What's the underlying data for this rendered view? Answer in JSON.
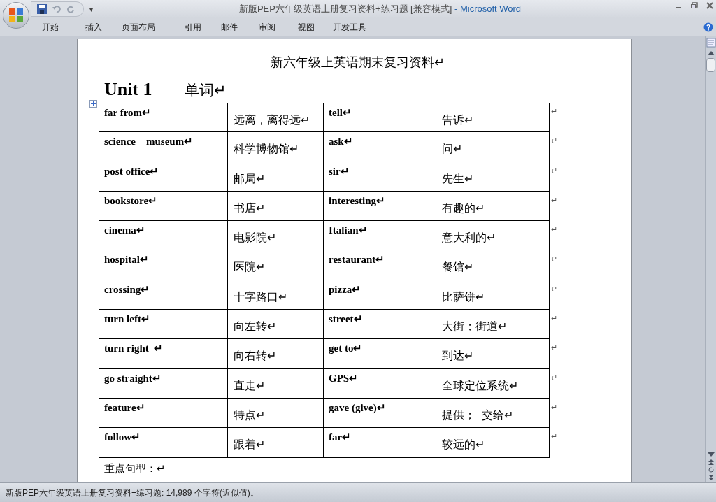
{
  "window": {
    "title": "新版PEP六年级英语上册复习资料+练习题 [兼容模式]",
    "app": "- Microsoft Word"
  },
  "quick_access": {
    "customize": "▾"
  },
  "tabs": [
    {
      "label": "开始",
      "selected": false
    },
    {
      "label": "插入",
      "selected": false
    },
    {
      "label": "页面布局",
      "selected": false
    },
    {
      "label": "引用",
      "selected": false
    },
    {
      "label": "邮件",
      "selected": false
    },
    {
      "label": "审阅",
      "selected": false
    },
    {
      "label": "视图",
      "selected": false
    },
    {
      "label": "开发工具",
      "selected": false
    }
  ],
  "document": {
    "title": "新六年级上英语期末复习资料↵",
    "unit": "Unit 1",
    "heading": "单词↵",
    "table": {
      "rows": [
        {
          "cells": [
            "far from↵",
            "远离，离得远↵",
            "tell↵",
            "告诉↵"
          ],
          "end_mark": "↵"
        },
        {
          "cells": [
            "science    museum↵",
            "科学博物馆↵",
            "ask↵",
            "问↵"
          ],
          "end_mark": "↵"
        },
        {
          "cells": [
            "post office↵",
            "邮局↵",
            "sir↵",
            "先生↵"
          ],
          "end_mark": "↵"
        },
        {
          "cells": [
            "bookstore↵",
            "书店↵",
            "interesting↵",
            "有趣的↵"
          ],
          "end_mark": "↵"
        },
        {
          "cells": [
            "cinema↵",
            "电影院↵",
            "Italian↵",
            "意大利的↵"
          ],
          "end_mark": "↵"
        },
        {
          "cells": [
            "hospital↵",
            "医院↵",
            "restaurant↵",
            "餐馆↵"
          ],
          "end_mark": "↵"
        },
        {
          "cells": [
            "crossing↵",
            "十字路口↵",
            "pizza↵",
            "比萨饼↵"
          ],
          "end_mark": "↵"
        },
        {
          "cells": [
            "turn left↵",
            "向左转↵",
            "street↵",
            "大街；街道↵"
          ],
          "end_mark": "↵"
        },
        {
          "cells": [
            "turn right  ↵",
            "向右转↵",
            "get to↵",
            "到达↵"
          ],
          "end_mark": "↵"
        },
        {
          "cells": [
            "go straight↵",
            "直走↵",
            "GPS↵",
            "全球定位系统↵"
          ],
          "end_mark": "↵"
        },
        {
          "cells": [
            "feature↵",
            "特点↵",
            "gave (give)↵",
            "提供；  交给↵"
          ],
          "end_mark": "↵"
        },
        {
          "cells": [
            "follow↵",
            "跟着↵",
            "far↵",
            "较远的↵"
          ],
          "end_mark": "↵"
        }
      ]
    },
    "after": "重点句型：↵"
  },
  "status_bar": {
    "text": "新版PEP六年级英语上册复习资料+练习题: 14,989 个字符(近似值)。"
  }
}
